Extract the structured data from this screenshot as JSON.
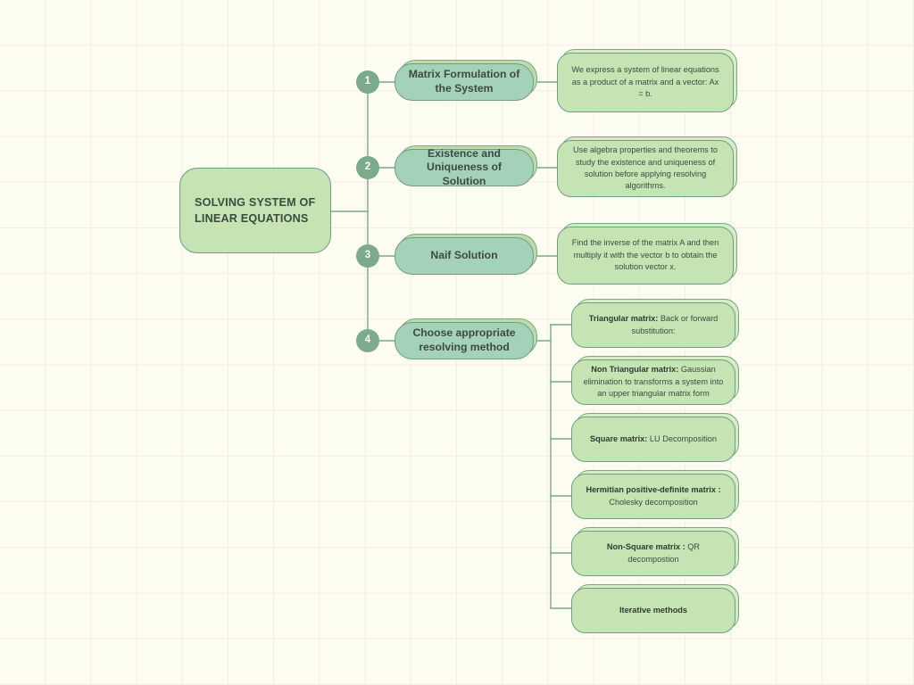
{
  "canvas": {
    "background_color": "#fefdf2",
    "grid_line_color": "#f7ece4",
    "grid_spacing_px": 51
  },
  "palette": {
    "central_fill": "#c6e3b3",
    "branch_fill": "#a4d2b8",
    "description_fill": "#c6e3b3",
    "node_border": "#6f9e81",
    "circle_fill": "#7cab8c",
    "circle_text": "#ffffff",
    "text_color": "#3c4a42",
    "connector_color": "#7aa886"
  },
  "central": {
    "title": "SOLVING SYSTEM OF LINEAR EQUATIONS"
  },
  "branches": [
    {
      "number": "1",
      "label": "Matrix Formulation of the System",
      "description": "We express a system of linear equations as a product of a matrix and a vector: Ax = b."
    },
    {
      "number": "2",
      "label": "Existence and Uniqueness of Solution",
      "description": "Use algebra properties and theorems to study the existence and uniqueness of solution before applying resolving algorithms."
    },
    {
      "number": "3",
      "label": "Naif Solution",
      "description": "Find the inverse of the matrix A and then multiply it with the vector b to obtain the solution vector x."
    },
    {
      "number": "4",
      "label": "Choose appropriate resolving method",
      "description": null
    }
  ],
  "methods": [
    {
      "term": "Triangular matrix:",
      "detail": " Back or forward substitution:"
    },
    {
      "term": "Non Triangular matrix:",
      "detail": " Gaussian elimination to transforms a system into an upper triangular matrix form"
    },
    {
      "term": "Square matrix:",
      "detail": " LU Decomposition"
    },
    {
      "term": "Hermitian positive-definite matrix :",
      "detail": " Cholesky decomposition"
    },
    {
      "term": "Non-Square matrix :",
      "detail": " QR decompostion"
    },
    {
      "term": "Iterative methods",
      "detail": ""
    }
  ]
}
